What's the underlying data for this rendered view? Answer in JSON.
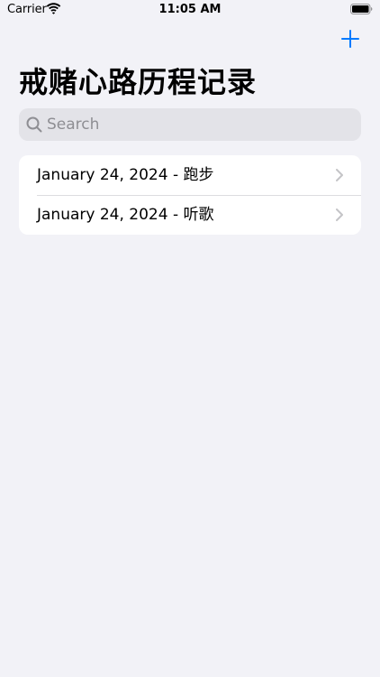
{
  "status_bar": {
    "carrier": "Carrier",
    "time": "11:05 AM",
    "wifi_icon": "wifi-icon",
    "battery_icon": "battery-full-icon"
  },
  "nav": {
    "add_icon": "plus-icon",
    "title": "戒赌心路历程记录"
  },
  "search": {
    "placeholder": "Search",
    "value": ""
  },
  "entries": [
    {
      "label": "January 24, 2024 - 跑步"
    },
    {
      "label": "January 24, 2024 - 听歌"
    }
  ],
  "colors": {
    "accent": "#007aff",
    "background": "#f2f2f7",
    "search_field": "#e3e3e8",
    "secondary_text": "#8e8e93",
    "chevron": "#c4c4c7"
  }
}
